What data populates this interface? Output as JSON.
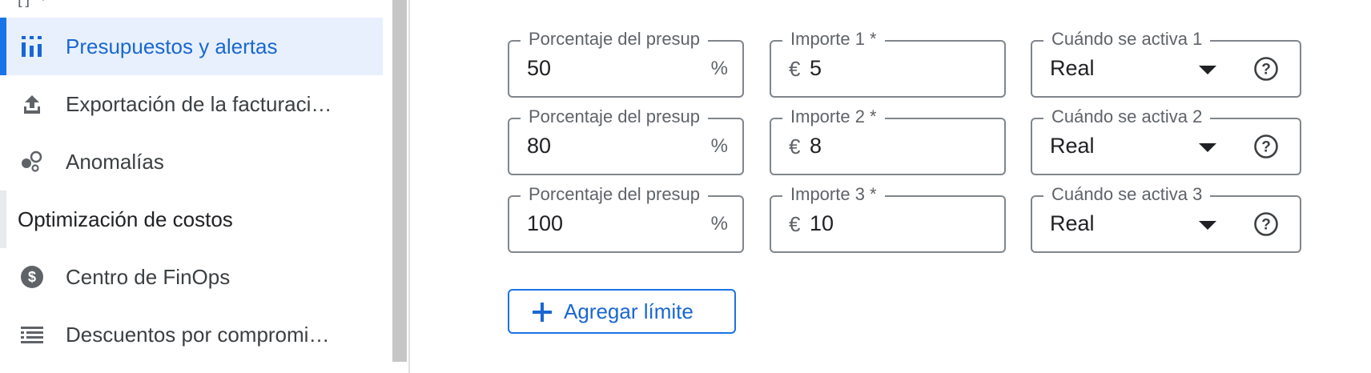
{
  "sidebar": {
    "top_clip": "[] ·",
    "items": [
      {
        "label": "Presupuestos y alertas",
        "icon": "budget-bars-icon",
        "active": true
      },
      {
        "label": "Exportación de la facturaci…",
        "icon": "export-upload-icon",
        "active": false
      },
      {
        "label": "Anomalías",
        "icon": "anomalies-icon",
        "active": false
      }
    ],
    "section": "Optimización de costos",
    "section_items": [
      {
        "label": "Centro de FinOps",
        "icon": "dollar-circle-icon"
      },
      {
        "label": "Descuentos por compromi…",
        "icon": "list-icon"
      }
    ]
  },
  "thresholds": [
    {
      "percent_label": "Porcentaje del presup",
      "percent_value": "50",
      "percent_suffix": "%",
      "amount_label": "Importe 1 *",
      "amount_prefix": "€",
      "amount_value": "5",
      "trigger_label": "Cuándo se activa 1",
      "trigger_value": "Real"
    },
    {
      "percent_label": "Porcentaje del presup",
      "percent_value": "80",
      "percent_suffix": "%",
      "amount_label": "Importe 2 *",
      "amount_prefix": "€",
      "amount_value": "8",
      "trigger_label": "Cuándo se activa 2",
      "trigger_value": "Real"
    },
    {
      "percent_label": "Porcentaje del presup",
      "percent_value": "100",
      "percent_suffix": "%",
      "amount_label": "Importe 3 *",
      "amount_prefix": "€",
      "amount_value": "10",
      "trigger_label": "Cuándo se activa 3",
      "trigger_value": "Real"
    }
  ],
  "add_button": {
    "label": "Agregar límite",
    "icon": "plus-icon"
  },
  "colors": {
    "accent": "#1a73e8",
    "active_bg": "#e8f0fe",
    "border": "#80868b"
  }
}
